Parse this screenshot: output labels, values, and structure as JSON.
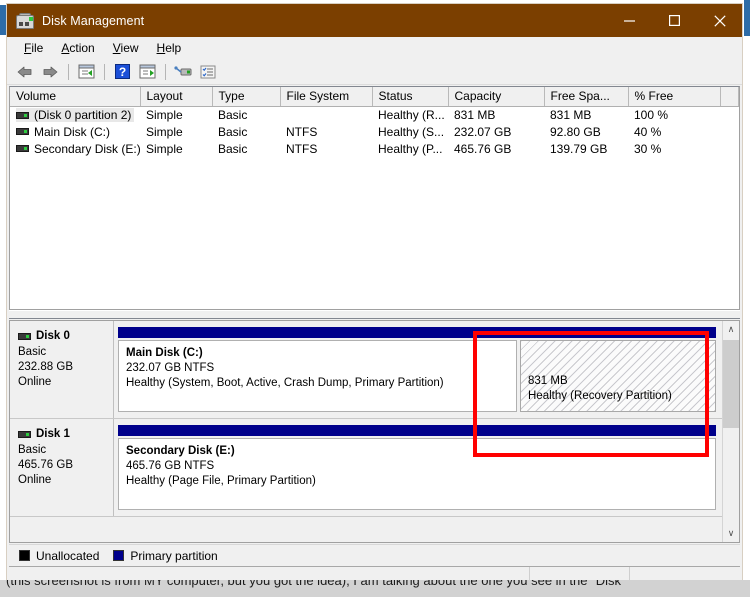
{
  "window": {
    "title": "Disk Management",
    "icon": "disk-management-icon",
    "controls": {
      "minimize": "Minimize",
      "maximize": "Maximize",
      "close": "Close"
    }
  },
  "menubar": {
    "items": [
      {
        "label": "File",
        "accel": "F"
      },
      {
        "label": "Action",
        "accel": "A"
      },
      {
        "label": "View",
        "accel": "V"
      },
      {
        "label": "Help",
        "accel": "H"
      }
    ]
  },
  "toolbar": {
    "buttons": [
      {
        "name": "back-arrow-icon",
        "tooltip": "Back"
      },
      {
        "name": "forward-arrow-icon",
        "tooltip": "Forward"
      },
      {
        "name": "show-hide-console-tree-icon",
        "tooltip": "Show/Hide Console Tree"
      },
      {
        "name": "help-icon",
        "tooltip": "Help"
      },
      {
        "name": "show-hide-action-pane-icon",
        "tooltip": "Show/Hide Action Pane"
      },
      {
        "name": "rescan-disks-icon",
        "tooltip": "Rescan Disks"
      },
      {
        "name": "properties-icon",
        "tooltip": "Properties"
      }
    ]
  },
  "volume_list": {
    "columns": [
      "Volume",
      "Layout",
      "Type",
      "File System",
      "Status",
      "Capacity",
      "Free Spa...",
      "% Free"
    ],
    "rows": [
      {
        "volume": "(Disk 0 partition 2)",
        "layout": "Simple",
        "type": "Basic",
        "filesystem": "",
        "status": "Healthy (R...",
        "capacity": "831 MB",
        "free_space": "831 MB",
        "percent_free": "100 %",
        "selected": true
      },
      {
        "volume": "Main Disk (C:)",
        "layout": "Simple",
        "type": "Basic",
        "filesystem": "NTFS",
        "status": "Healthy (S...",
        "capacity": "232.07 GB",
        "free_space": "92.80 GB",
        "percent_free": "40 %",
        "selected": false
      },
      {
        "volume": "Secondary Disk (E:)",
        "layout": "Simple",
        "type": "Basic",
        "filesystem": "NTFS",
        "status": "Healthy (P...",
        "capacity": "465.76 GB",
        "free_space": "139.79 GB",
        "percent_free": "30 %",
        "selected": false
      }
    ]
  },
  "graphical_view": {
    "disks": [
      {
        "name": "Disk 0",
        "type": "Basic",
        "size": "232.88 GB",
        "status": "Online",
        "partitions": [
          {
            "title": "Main Disk  (C:)",
            "size": "232.07 GB NTFS",
            "status": "Healthy (System, Boot, Active, Crash Dump, Primary Partition)",
            "style": "primary"
          },
          {
            "title": "",
            "size": "831 MB",
            "status": "Healthy (Recovery Partition)",
            "style": "recovery",
            "highlighted": true
          }
        ]
      },
      {
        "name": "Disk 1",
        "type": "Basic",
        "size": "465.76 GB",
        "status": "Online",
        "partitions": [
          {
            "title": "Secondary Disk  (E:)",
            "size": "465.76 GB NTFS",
            "status": "Healthy (Page File, Primary Partition)",
            "style": "primary"
          }
        ]
      }
    ],
    "scrollbar": {
      "up_arrow": "∧",
      "down_arrow": "∨"
    }
  },
  "legend": {
    "items": [
      {
        "label": "Unallocated",
        "color": "#000000"
      },
      {
        "label": "Primary partition",
        "color": "#00008b"
      }
    ]
  },
  "colors": {
    "titlebar": "#7b3f00",
    "partition_bar": "#00008b",
    "highlight_box": "#ff0000",
    "window_bg": "#f0f0f0"
  },
  "page_footer": {
    "clipped_text": "(this screenshot is from MY computer, but you got the idea), I am talking about the one you see in the \"Disk"
  }
}
